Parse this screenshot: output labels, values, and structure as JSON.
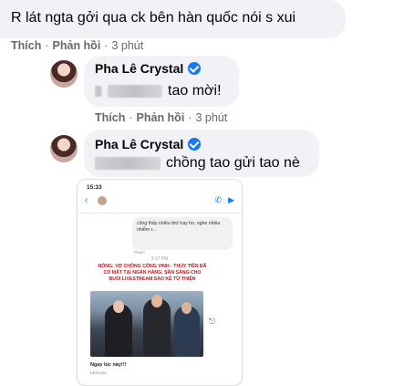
{
  "comments": [
    {
      "text": "R lát ngta gởi qua ck bên hàn quốc nói s xui",
      "actions": {
        "like": "Thích",
        "reply": "Phản hồi",
        "time": "3 phút"
      }
    },
    {
      "author": "Pha Lê Crystal",
      "text": "tao mời!",
      "actions": {
        "like": "Thích",
        "reply": "Phản hồi",
        "time": "3 phút"
      }
    },
    {
      "author": "Pha Lê Crystal",
      "text": "chồng tao gửi tao nè"
    }
  ],
  "attachment": {
    "status_time": "15:33",
    "bubble_text": "cũng thấy nhiều thứ hay ho, nghe nhiều nhiễm r...",
    "bubble_sub": "Phạm",
    "chat_time": "3:17 PM",
    "headline": "NÓNG: VỢ CHỒNG CÔNG VINH - THỦY TIÊN ĐÃ CÓ MẶT TẠI NGÂN HÀNG, SẴN SÀNG CHO BUỔI LIVESTREAM SAO KÊ TỪ THIỆN",
    "caption": "Ngay lúc này!!!",
    "caption_sub": "Idol Live"
  }
}
